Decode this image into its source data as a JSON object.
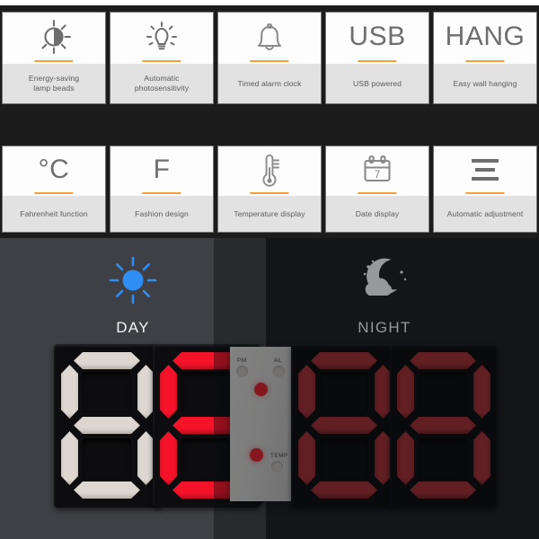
{
  "feature_rows": [
    {
      "row_id": "row-1",
      "cards": [
        {
          "icon": "brightness-half-sun-icon",
          "glyph_type": "svg",
          "label": "Energy-saving\nlamp beads",
          "label_line1": "Energy-saving",
          "label_line2": "lamp beads"
        },
        {
          "icon": "light-bulb-icon",
          "glyph_type": "svg",
          "label": "Automatic\nphotosensitivity",
          "label_line1": "Automatic",
          "label_line2": "photosensitivity"
        },
        {
          "icon": "bell-icon",
          "glyph_type": "svg",
          "label": "Timed alarm clock",
          "label_line1": "Timed alarm clock",
          "label_line2": ""
        },
        {
          "icon": "usb-text-icon",
          "glyph_type": "text",
          "glyph": "USB",
          "label": "USB powered",
          "label_line1": "USB powered",
          "label_line2": ""
        },
        {
          "icon": "hang-text-icon",
          "glyph_type": "text",
          "glyph": "HANG",
          "label": "Easy wall hanging",
          "label_line1": "Easy wall hanging",
          "label_line2": ""
        }
      ]
    },
    {
      "row_id": "row-2",
      "cards": [
        {
          "icon": "celsius-text-icon",
          "glyph_type": "text",
          "glyph": "°C",
          "label": "Fahrenheit function",
          "label_line1": "Fahrenheit function",
          "label_line2": ""
        },
        {
          "icon": "fahrenheit-text-icon",
          "glyph_type": "text",
          "glyph": "F",
          "label": "Fashion design",
          "label_line1": "Fashion design",
          "label_line2": ""
        },
        {
          "icon": "thermometer-icon",
          "glyph_type": "svg",
          "label": "Temperature display",
          "label_line1": "Temperature display",
          "label_line2": ""
        },
        {
          "icon": "calendar-icon",
          "glyph_type": "svg",
          "glyph": "7",
          "label": "Date display",
          "label_line1": "Date display",
          "label_line2": ""
        },
        {
          "icon": "hamburger-lines-icon",
          "glyph_type": "svg",
          "label": "Automatic adjustment",
          "label_line1": "Automatic adjustment",
          "label_line2": ""
        }
      ]
    }
  ],
  "scene": {
    "day": {
      "icon": "sun-icon",
      "label": "DAY",
      "icon_color": "#2f8ef4",
      "bg_color": "#3e4045"
    },
    "night": {
      "icon": "moon-cloud-stars-icon",
      "label": "NIGHT",
      "icon_color": "#ffffff",
      "bg_color": "#1a1c21"
    }
  },
  "clock": {
    "digits": [
      {
        "position": 1,
        "value": "8",
        "state": "unlit",
        "color": "#ded7d1"
      },
      {
        "position": 2,
        "value": "8",
        "state": "lit-bright",
        "color": "#f6132a"
      },
      {
        "position": 3,
        "value": "8",
        "state": "lit-dim",
        "color": "#a02c33"
      },
      {
        "position": 4,
        "value": "8",
        "state": "lit-dim",
        "color": "#a02c33"
      }
    ],
    "panel": {
      "indicator_pm": "PM",
      "indicator_al": "AL",
      "indicator_temp": "TEMP",
      "colon_color": "#e0202c"
    }
  },
  "colors": {
    "accent_orange": "#f5a03c",
    "card_label_bg": "#e2e2e2",
    "band_black": "#1c1c1c",
    "day_blue": "#2f8ef4",
    "digit_red": "#f6132a"
  }
}
